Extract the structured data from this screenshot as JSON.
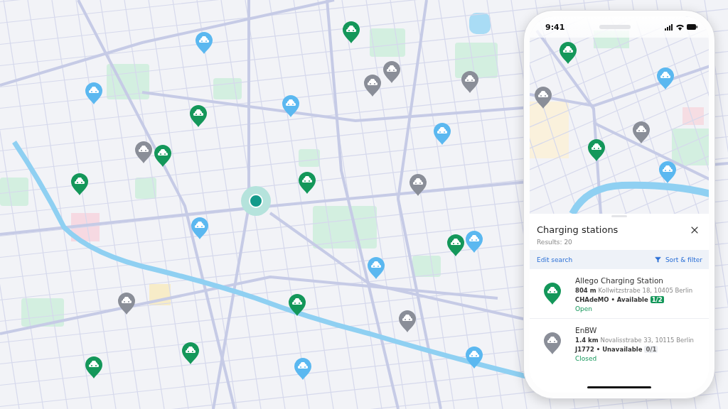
{
  "map_pins": [
    {
      "color": "#5bb8f0"
    },
    {
      "color": "#14975a"
    },
    {
      "color": "#5bb8f0"
    },
    {
      "color": "#14975a"
    },
    {
      "color": "#5bb8f0"
    },
    {
      "color": "#8a8e98"
    },
    {
      "color": "#8a8e98"
    },
    {
      "color": "#8a8e98"
    },
    {
      "color": "#8a8e98"
    },
    {
      "color": "#14975a"
    },
    {
      "color": "#14975a"
    },
    {
      "color": "#14975a"
    },
    {
      "color": "#8a8e98"
    },
    {
      "color": "#5bb8f0"
    },
    {
      "color": "#5bb8f0"
    },
    {
      "color": "#5bb8f0"
    },
    {
      "color": "#14975a"
    },
    {
      "color": "#5bb8f0"
    },
    {
      "color": "#8a8e98"
    },
    {
      "color": "#14975a"
    },
    {
      "color": "#8a8e98"
    },
    {
      "color": "#14975a"
    },
    {
      "color": "#14975a"
    },
    {
      "color": "#5bb8f0"
    },
    {
      "color": "#5bb8f0"
    }
  ],
  "phone": {
    "status_bar": {
      "time": "9:41"
    },
    "map_pins": [
      {
        "color": "#14975a"
      },
      {
        "color": "#5bb8f0"
      },
      {
        "color": "#8a8e98"
      },
      {
        "color": "#8a8e98"
      },
      {
        "color": "#14975a"
      },
      {
        "color": "#5bb8f0"
      }
    ],
    "sheet": {
      "title": "Charging stations",
      "results": "Results: 20",
      "edit_search": "Edit search",
      "sort_filter": "Sort & filter",
      "stations": [
        {
          "name": "Allego Charging Station",
          "distance": "804 m",
          "address": "Kollwitzstrabe 18, 10405 Berlin",
          "connector": "CHAdeMO • Available",
          "count": "1/2",
          "available": true,
          "status": "Open",
          "color": "#14975a"
        },
        {
          "name": "EnBW",
          "distance": "1.4 km",
          "address": "Novalisstrabe 33, 10115 Berlin",
          "connector": "J1772 • Unavailable",
          "count": "0/1",
          "available": false,
          "status": "Closed",
          "color": "#8a8e98"
        }
      ]
    }
  }
}
